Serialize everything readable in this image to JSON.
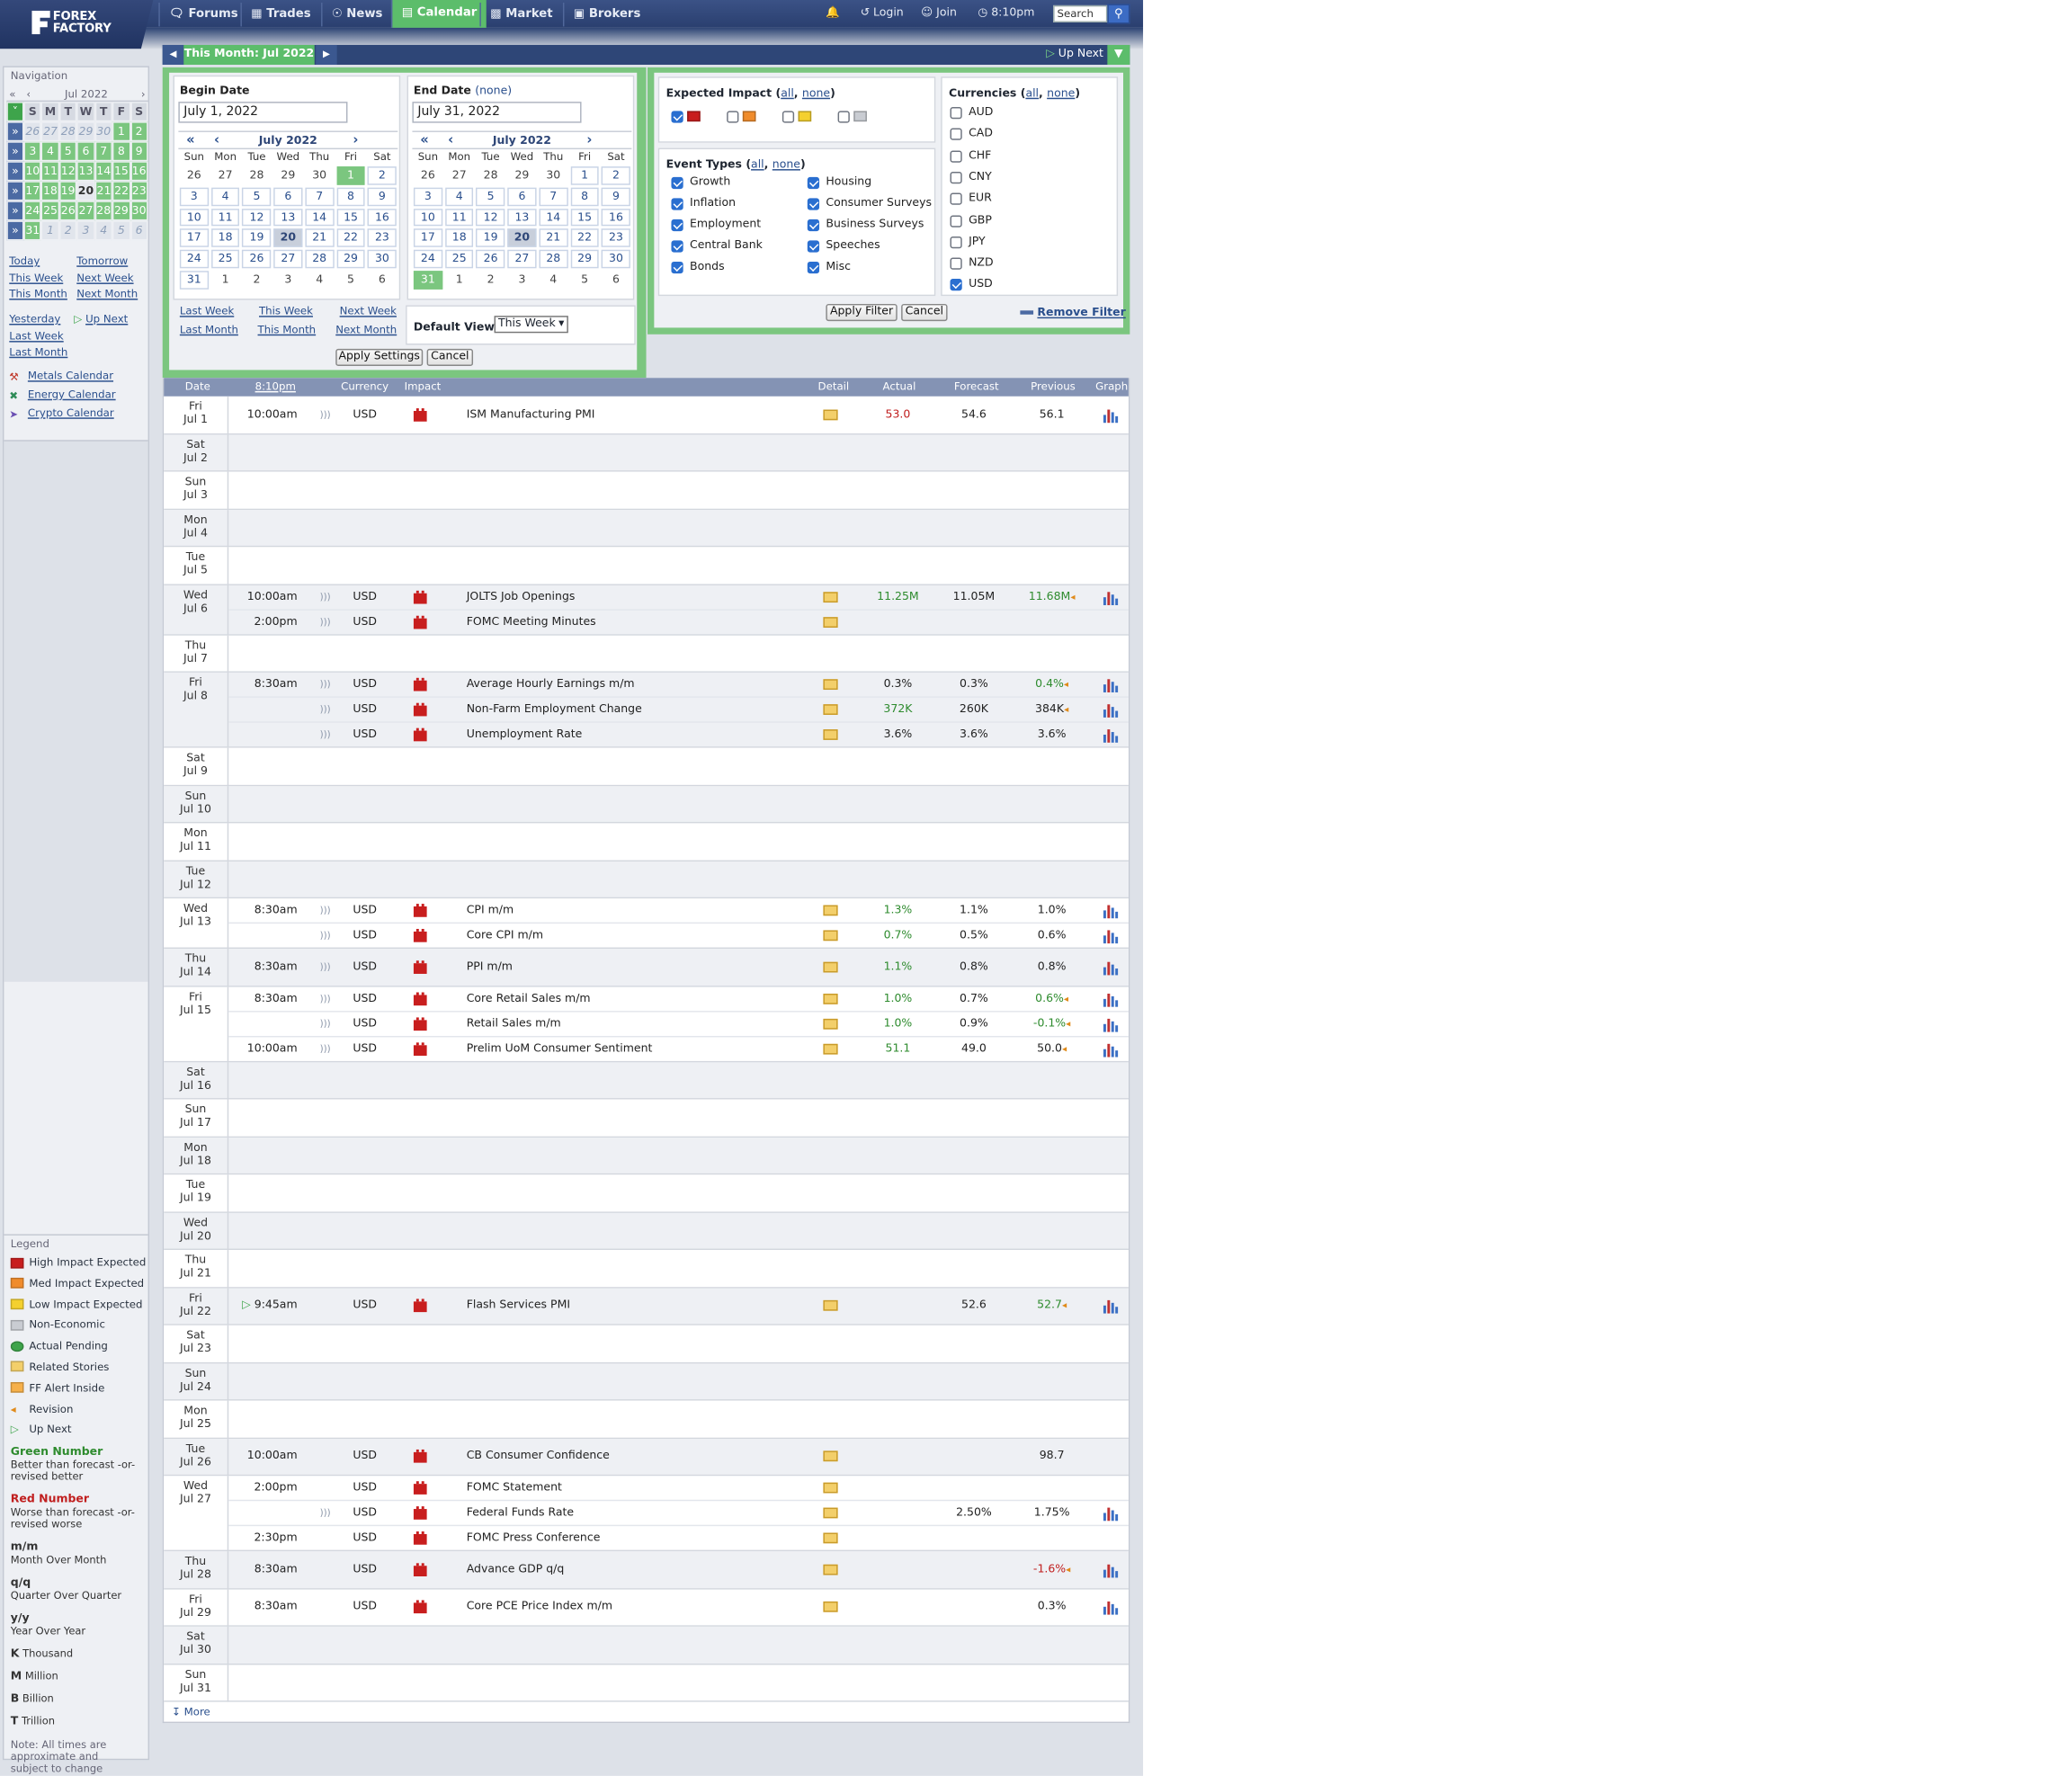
{
  "header": {
    "logo_line1": "FOREX",
    "logo_line2": "FACTORY",
    "tabs": [
      "Forums",
      "Trades",
      "News",
      "Calendar",
      "Market",
      "Brokers"
    ],
    "active_tab": "Calendar",
    "login": "Login",
    "join": "Join",
    "time": "8:10pm",
    "search_placeholder": "Search"
  },
  "sidebar": {
    "nav_title": "Navigation",
    "month_label": "Jul 2022",
    "day_headers": [
      "S",
      "M",
      "T",
      "W",
      "T",
      "F",
      "S"
    ],
    "weeks": [
      [
        "26",
        "27",
        "28",
        "29",
        "30",
        "1",
        "2"
      ],
      [
        "3",
        "4",
        "5",
        "6",
        "7",
        "8",
        "9"
      ],
      [
        "10",
        "11",
        "12",
        "13",
        "14",
        "15",
        "16"
      ],
      [
        "17",
        "18",
        "19",
        "20",
        "21",
        "22",
        "23"
      ],
      [
        "24",
        "25",
        "26",
        "27",
        "28",
        "29",
        "30"
      ],
      [
        "31",
        "1",
        "2",
        "3",
        "4",
        "5",
        "6"
      ]
    ],
    "links": [
      "Today",
      "Tomorrow",
      "This Week",
      "Next Week",
      "This Month",
      "Next Month",
      "Yesterday",
      "Up Next",
      "Last Week",
      "Last Month"
    ],
    "ext_links": [
      "Metals Calendar",
      "Energy Calendar",
      "Crypto Calendar"
    ],
    "legend_title": "Legend",
    "legend": [
      "High Impact Expected",
      "Med Impact Expected",
      "Low Impact Expected",
      "Non-Economic",
      "Actual Pending",
      "Related Stories",
      "FF Alert Inside",
      "Revision",
      "Up Next"
    ],
    "green_number_title": "Green Number",
    "green_number_desc": "Better than forecast -or- revised better",
    "red_number_title": "Red Number",
    "red_number_desc": "Worse than forecast -or- revised worse",
    "abbrev": [
      {
        "k": "m/m",
        "v": "Month Over Month"
      },
      {
        "k": "q/q",
        "v": "Quarter Over Quarter"
      },
      {
        "k": "y/y",
        "v": "Year Over Year"
      }
    ],
    "units": [
      {
        "k": "K",
        "v": "Thousand"
      },
      {
        "k": "M",
        "v": "Million"
      },
      {
        "k": "B",
        "v": "Billion"
      },
      {
        "k": "T",
        "v": "Trillion"
      }
    ],
    "note": "Note: All times are approximate and subject to change"
  },
  "month_bar": {
    "label": "This Month: Jul 2022",
    "up_next": "Up Next"
  },
  "settings": {
    "begin_label": "Begin Date",
    "begin_value": "July 1, 2022",
    "end_label": "End Date",
    "end_none": "(none)",
    "end_value": "July 31, 2022",
    "cal_month": "July 2022",
    "dow": [
      "Sun",
      "Mon",
      "Tue",
      "Wed",
      "Thu",
      "Fri",
      "Sat"
    ],
    "quick_links": [
      "Last Week",
      "This Week",
      "Next Week",
      "Last Month",
      "This Month",
      "Next Month"
    ],
    "default_view_label": "Default View",
    "default_view_value": "This Week",
    "apply_label": "Apply Settings",
    "cancel_label": "Cancel"
  },
  "filters": {
    "impact_title": "Expected Impact",
    "all": "all",
    "none": "none",
    "event_types_title": "Event Types",
    "event_types": [
      {
        "label": "Growth",
        "on": true
      },
      {
        "label": "Housing",
        "on": true
      },
      {
        "label": "Inflation",
        "on": true
      },
      {
        "label": "Consumer Surveys",
        "on": true
      },
      {
        "label": "Employment",
        "on": true
      },
      {
        "label": "Business Surveys",
        "on": true
      },
      {
        "label": "Central Bank",
        "on": true
      },
      {
        "label": "Speeches",
        "on": true
      },
      {
        "label": "Bonds",
        "on": true
      },
      {
        "label": "Misc",
        "on": true
      }
    ],
    "currencies_title": "Currencies",
    "currencies": [
      {
        "label": "AUD",
        "on": false
      },
      {
        "label": "CAD",
        "on": false
      },
      {
        "label": "CHF",
        "on": false
      },
      {
        "label": "CNY",
        "on": false
      },
      {
        "label": "EUR",
        "on": false
      },
      {
        "label": "GBP",
        "on": false
      },
      {
        "label": "JPY",
        "on": false
      },
      {
        "label": "NZD",
        "on": false
      },
      {
        "label": "USD",
        "on": true
      }
    ],
    "apply_label": "Apply Filter",
    "cancel_label": "Cancel",
    "remove_label": "Remove Filter"
  },
  "table": {
    "columns": [
      "Date",
      "8:10pm",
      "Currency",
      "Impact",
      "Detail",
      "Actual",
      "Forecast",
      "Previous",
      "Graph"
    ],
    "more_label": "More",
    "days": [
      {
        "dow": "Fri",
        "date": "Jul 1",
        "events": [
          {
            "time": "10:00am",
            "cur": "USD",
            "name": "ISM Manufacturing PMI",
            "actual": "53.0",
            "actual_cls": "red",
            "forecast": "54.6",
            "previous": "56.1",
            "prev_cls": "",
            "rev": false,
            "graph": true
          }
        ]
      },
      {
        "dow": "Sat",
        "date": "Jul 2",
        "events": []
      },
      {
        "dow": "Sun",
        "date": "Jul 3",
        "events": []
      },
      {
        "dow": "Mon",
        "date": "Jul 4",
        "events": []
      },
      {
        "dow": "Tue",
        "date": "Jul 5",
        "events": []
      },
      {
        "dow": "Wed",
        "date": "Jul 6",
        "events": [
          {
            "time": "10:00am",
            "cur": "USD",
            "name": "JOLTS Job Openings",
            "actual": "11.25M",
            "actual_cls": "green",
            "forecast": "11.05M",
            "previous": "11.68M",
            "prev_cls": "green",
            "rev": true,
            "graph": true
          },
          {
            "time": "2:00pm",
            "cur": "USD",
            "name": "FOMC Meeting Minutes",
            "actual": "",
            "actual_cls": "",
            "forecast": "",
            "previous": "",
            "prev_cls": "",
            "rev": false,
            "graph": false
          }
        ]
      },
      {
        "dow": "Thu",
        "date": "Jul 7",
        "events": []
      },
      {
        "dow": "Fri",
        "date": "Jul 8",
        "events": [
          {
            "time": "8:30am",
            "cur": "USD",
            "name": "Average Hourly Earnings m/m",
            "actual": "0.3%",
            "actual_cls": "",
            "forecast": "0.3%",
            "previous": "0.4%",
            "prev_cls": "green",
            "rev": true,
            "graph": true
          },
          {
            "time": "",
            "cur": "USD",
            "name": "Non-Farm Employment Change",
            "actual": "372K",
            "actual_cls": "green",
            "forecast": "260K",
            "previous": "384K",
            "prev_cls": "",
            "rev": true,
            "graph": true
          },
          {
            "time": "",
            "cur": "USD",
            "name": "Unemployment Rate",
            "actual": "3.6%",
            "actual_cls": "",
            "forecast": "3.6%",
            "previous": "3.6%",
            "prev_cls": "",
            "rev": false,
            "graph": true
          }
        ]
      },
      {
        "dow": "Sat",
        "date": "Jul 9",
        "events": []
      },
      {
        "dow": "Sun",
        "date": "Jul 10",
        "events": []
      },
      {
        "dow": "Mon",
        "date": "Jul 11",
        "events": []
      },
      {
        "dow": "Tue",
        "date": "Jul 12",
        "events": []
      },
      {
        "dow": "Wed",
        "date": "Jul 13",
        "events": [
          {
            "time": "8:30am",
            "cur": "USD",
            "name": "CPI m/m",
            "actual": "1.3%",
            "actual_cls": "green",
            "forecast": "1.1%",
            "previous": "1.0%",
            "prev_cls": "",
            "rev": false,
            "graph": true
          },
          {
            "time": "",
            "cur": "USD",
            "name": "Core CPI m/m",
            "actual": "0.7%",
            "actual_cls": "green",
            "forecast": "0.5%",
            "previous": "0.6%",
            "prev_cls": "",
            "rev": false,
            "graph": true
          }
        ]
      },
      {
        "dow": "Thu",
        "date": "Jul 14",
        "events": [
          {
            "time": "8:30am",
            "cur": "USD",
            "name": "PPI m/m",
            "actual": "1.1%",
            "actual_cls": "green",
            "forecast": "0.8%",
            "previous": "0.8%",
            "prev_cls": "",
            "rev": false,
            "graph": true
          }
        ]
      },
      {
        "dow": "Fri",
        "date": "Jul 15",
        "events": [
          {
            "time": "8:30am",
            "cur": "USD",
            "name": "Core Retail Sales m/m",
            "actual": "1.0%",
            "actual_cls": "green",
            "forecast": "0.7%",
            "previous": "0.6%",
            "prev_cls": "green",
            "rev": true,
            "graph": true
          },
          {
            "time": "",
            "cur": "USD",
            "name": "Retail Sales m/m",
            "actual": "1.0%",
            "actual_cls": "green",
            "forecast": "0.9%",
            "previous": "-0.1%",
            "prev_cls": "green",
            "rev": true,
            "graph": true
          },
          {
            "time": "10:00am",
            "cur": "USD",
            "name": "Prelim UoM Consumer Sentiment",
            "actual": "51.1",
            "actual_cls": "green",
            "forecast": "49.0",
            "previous": "50.0",
            "prev_cls": "",
            "rev": true,
            "graph": true
          }
        ]
      },
      {
        "dow": "Sat",
        "date": "Jul 16",
        "events": []
      },
      {
        "dow": "Sun",
        "date": "Jul 17",
        "events": []
      },
      {
        "dow": "Mon",
        "date": "Jul 18",
        "events": []
      },
      {
        "dow": "Tue",
        "date": "Jul 19",
        "events": []
      },
      {
        "dow": "Wed",
        "date": "Jul 20",
        "events": []
      },
      {
        "dow": "Thu",
        "date": "Jul 21",
        "events": []
      },
      {
        "dow": "Fri",
        "date": "Jul 22",
        "events": [
          {
            "time": "9:45am",
            "upnext": true,
            "cur": "USD",
            "name": "Flash Services PMI",
            "actual": "",
            "actual_cls": "",
            "forecast": "52.6",
            "previous": "52.7",
            "prev_cls": "green",
            "rev": true,
            "graph": true,
            "nosound": true
          }
        ]
      },
      {
        "dow": "Sat",
        "date": "Jul 23",
        "events": []
      },
      {
        "dow": "Sun",
        "date": "Jul 24",
        "events": []
      },
      {
        "dow": "Mon",
        "date": "Jul 25",
        "events": []
      },
      {
        "dow": "Tue",
        "date": "Jul 26",
        "events": [
          {
            "time": "10:00am",
            "cur": "USD",
            "name": "CB Consumer Confidence",
            "actual": "",
            "actual_cls": "",
            "forecast": "",
            "previous": "98.7",
            "prev_cls": "",
            "rev": false,
            "graph": false,
            "nosound": true
          }
        ]
      },
      {
        "dow": "Wed",
        "date": "Jul 27",
        "events": [
          {
            "time": "2:00pm",
            "cur": "USD",
            "name": "FOMC Statement",
            "actual": "",
            "actual_cls": "",
            "forecast": "",
            "previous": "",
            "prev_cls": "",
            "rev": false,
            "graph": false,
            "nosound": true
          },
          {
            "time": "",
            "cur": "USD",
            "name": "Federal Funds Rate",
            "actual": "",
            "actual_cls": "",
            "forecast": "2.50%",
            "previous": "1.75%",
            "prev_cls": "",
            "rev": false,
            "graph": true
          },
          {
            "time": "2:30pm",
            "cur": "USD",
            "name": "FOMC Press Conference",
            "actual": "",
            "actual_cls": "",
            "forecast": "",
            "previous": "",
            "prev_cls": "",
            "rev": false,
            "graph": false,
            "nosound": true
          }
        ]
      },
      {
        "dow": "Thu",
        "date": "Jul 28",
        "events": [
          {
            "time": "8:30am",
            "cur": "USD",
            "name": "Advance GDP q/q",
            "actual": "",
            "actual_cls": "",
            "forecast": "",
            "previous": "-1.6%",
            "prev_cls": "red",
            "rev": true,
            "graph": true,
            "nosound": true
          }
        ]
      },
      {
        "dow": "Fri",
        "date": "Jul 29",
        "events": [
          {
            "time": "8:30am",
            "cur": "USD",
            "name": "Core PCE Price Index m/m",
            "actual": "",
            "actual_cls": "",
            "forecast": "",
            "previous": "0.3%",
            "prev_cls": "",
            "rev": false,
            "graph": true,
            "nosound": true
          }
        ]
      },
      {
        "dow": "Sat",
        "date": "Jul 30",
        "events": []
      },
      {
        "dow": "Sun",
        "date": "Jul 31",
        "events": []
      }
    ]
  }
}
